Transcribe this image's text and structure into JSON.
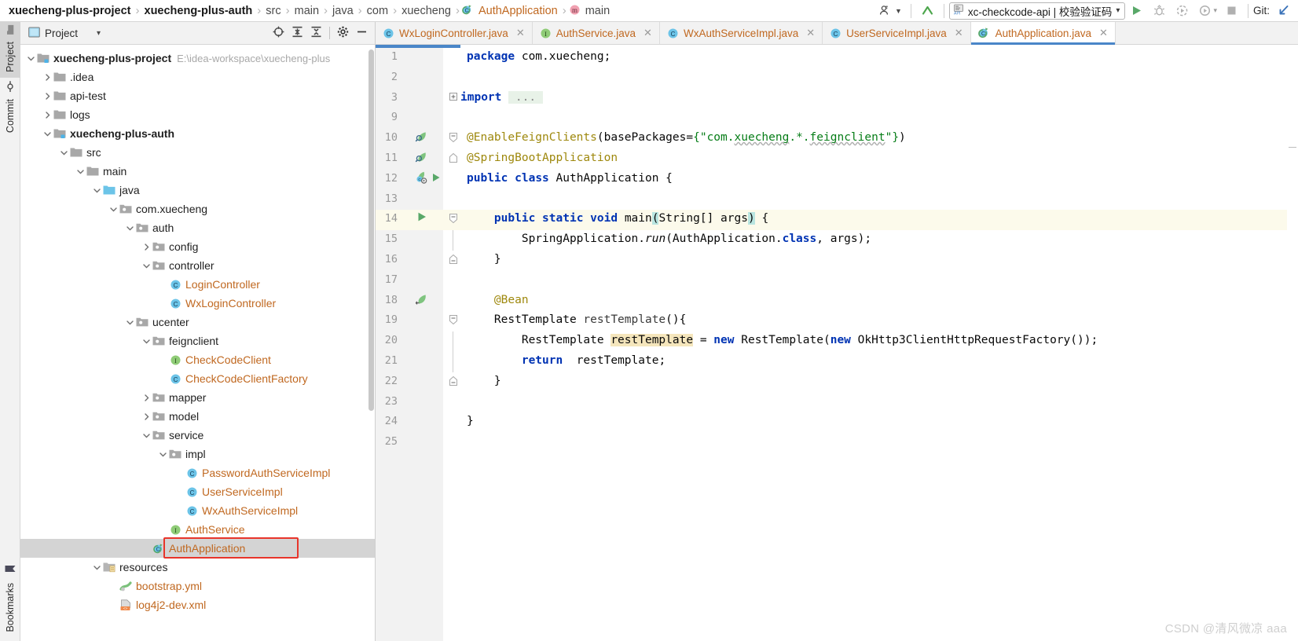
{
  "breadcrumb": {
    "items": [
      {
        "label": "xuecheng-plus-project",
        "style": "bold"
      },
      {
        "label": "xuecheng-plus-auth",
        "style": "bold"
      },
      {
        "label": "src",
        "style": "plain"
      },
      {
        "label": "main",
        "style": "plain"
      },
      {
        "label": "java",
        "style": "plain"
      },
      {
        "label": "com",
        "style": "plain"
      },
      {
        "label": "xuecheng",
        "style": "plain"
      },
      {
        "label": "AuthApplication",
        "style": "class",
        "icon": "spring-class-icon"
      },
      {
        "label": "main",
        "style": "method",
        "icon": "method-icon"
      }
    ],
    "separator": "›"
  },
  "toolbar": {
    "user_icon": "user-dropdown-icon",
    "updates_icon": "updates-arrow-icon",
    "run_config": {
      "icon": "api-icon",
      "label": "xc-checkcode-api | 校验验证码",
      "chevron": "▾"
    },
    "run_button": "run-icon",
    "debug_button": "debug-icon",
    "run_coverage_button": "run-with-coverage-icon",
    "profiler_button": "profiler-icon",
    "profiler_chevron": "▾",
    "stop_button": "stop-icon",
    "git_label": "Git:",
    "git_update_icon": "git-update-project-icon"
  },
  "stripe": {
    "top_tabs": [
      {
        "label": "Project",
        "icon": "project-folder-icon",
        "active": true
      },
      {
        "label": "Commit",
        "icon": "commit-icon",
        "active": false
      }
    ],
    "bottom_tabs": [
      {
        "label": "Bookmarks",
        "icon": "bookmark-icon",
        "active": false
      }
    ]
  },
  "project_panel": {
    "title": "Project",
    "title_icon": "project-view-icon",
    "chevron": "▾",
    "actions": [
      {
        "name": "select-opened-file-icon",
        "glyph": "target"
      },
      {
        "name": "expand-all-icon",
        "glyph": "expand"
      },
      {
        "name": "collapse-all-icon",
        "glyph": "collapse"
      },
      {
        "name": "settings-gear-icon",
        "glyph": "gear"
      },
      {
        "name": "hide-panel-icon",
        "glyph": "minus"
      }
    ],
    "tree": [
      {
        "depth": 0,
        "arrow": "down",
        "icon": "module-folder",
        "label": "xuecheng-plus-project",
        "bold": true,
        "path": "E:\\idea-workspace\\xuecheng-plus"
      },
      {
        "depth": 1,
        "arrow": "right",
        "icon": "folder",
        "label": ".idea",
        "bold": false
      },
      {
        "depth": 1,
        "arrow": "right",
        "icon": "folder",
        "label": "api-test",
        "bold": false
      },
      {
        "depth": 1,
        "arrow": "right",
        "icon": "folder",
        "label": "logs",
        "bold": false
      },
      {
        "depth": 1,
        "arrow": "down",
        "icon": "module-folder",
        "label": "xuecheng-plus-auth",
        "bold": true
      },
      {
        "depth": 2,
        "arrow": "down",
        "icon": "folder",
        "label": "src",
        "bold": false
      },
      {
        "depth": 3,
        "arrow": "down",
        "icon": "folder",
        "label": "main",
        "bold": false
      },
      {
        "depth": 4,
        "arrow": "down",
        "icon": "source-root",
        "label": "java",
        "bold": false
      },
      {
        "depth": 5,
        "arrow": "down",
        "icon": "package",
        "label": "com.xuecheng",
        "bold": false
      },
      {
        "depth": 6,
        "arrow": "down",
        "icon": "package",
        "label": "auth",
        "bold": false
      },
      {
        "depth": 7,
        "arrow": "right",
        "icon": "package",
        "label": "config",
        "bold": false
      },
      {
        "depth": 7,
        "arrow": "down",
        "icon": "package",
        "label": "controller",
        "bold": false
      },
      {
        "depth": 8,
        "arrow": "none",
        "icon": "class",
        "label": "LoginController",
        "bold": false
      },
      {
        "depth": 8,
        "arrow": "none",
        "icon": "class",
        "label": "WxLoginController",
        "bold": false
      },
      {
        "depth": 6,
        "arrow": "down",
        "icon": "package",
        "label": "ucenter",
        "bold": false
      },
      {
        "depth": 7,
        "arrow": "down",
        "icon": "package",
        "label": "feignclient",
        "bold": false
      },
      {
        "depth": 8,
        "arrow": "none",
        "icon": "interface",
        "label": "CheckCodeClient",
        "bold": false
      },
      {
        "depth": 8,
        "arrow": "none",
        "icon": "class",
        "label": "CheckCodeClientFactory",
        "bold": false
      },
      {
        "depth": 7,
        "arrow": "right",
        "icon": "package",
        "label": "mapper",
        "bold": false
      },
      {
        "depth": 7,
        "arrow": "right",
        "icon": "package",
        "label": "model",
        "bold": false
      },
      {
        "depth": 7,
        "arrow": "down",
        "icon": "package",
        "label": "service",
        "bold": false
      },
      {
        "depth": 8,
        "arrow": "down",
        "icon": "package",
        "label": "impl",
        "bold": false
      },
      {
        "depth": 9,
        "arrow": "none",
        "icon": "class",
        "label": "PasswordAuthServiceImpl",
        "bold": false
      },
      {
        "depth": 9,
        "arrow": "none",
        "icon": "class",
        "label": "UserServiceImpl",
        "bold": false
      },
      {
        "depth": 9,
        "arrow": "none",
        "icon": "class",
        "label": "WxAuthServiceImpl",
        "bold": false
      },
      {
        "depth": 8,
        "arrow": "none",
        "icon": "interface",
        "label": "AuthService",
        "bold": false
      },
      {
        "depth": 7,
        "arrow": "none",
        "icon": "spring-class",
        "label": "AuthApplication",
        "bold": false,
        "selected": true,
        "annotated": true
      },
      {
        "depth": 4,
        "arrow": "down",
        "icon": "resource-root",
        "label": "resources",
        "bold": false
      },
      {
        "depth": 5,
        "arrow": "none",
        "icon": "yaml",
        "label": "bootstrap.yml",
        "bold": false
      },
      {
        "depth": 5,
        "arrow": "none",
        "icon": "xml",
        "label": "log4j2-dev.xml",
        "bold": false
      }
    ]
  },
  "editor_tabs": [
    {
      "label": "WxLoginController.java",
      "icon": "class",
      "active": false,
      "close": "✕"
    },
    {
      "label": "AuthService.java",
      "icon": "interface",
      "active": false,
      "close": "✕"
    },
    {
      "label": "WxAuthServiceImpl.java",
      "icon": "class",
      "active": false,
      "close": "✕"
    },
    {
      "label": "UserServiceImpl.java",
      "icon": "class",
      "active": false,
      "close": "✕"
    },
    {
      "label": "AuthApplication.java",
      "icon": "spring-class",
      "active": true,
      "close": "✕"
    }
  ],
  "code": {
    "lines": [
      {
        "num": "1",
        "gutter": "none",
        "fold": "none"
      },
      {
        "num": "2",
        "gutter": "none",
        "fold": "none"
      },
      {
        "num": "3",
        "gutter": "none",
        "fold": "plus"
      },
      {
        "num": "9",
        "gutter": "none",
        "fold": "none"
      },
      {
        "num": "10",
        "gutter": "spring",
        "fold": "top"
      },
      {
        "num": "11",
        "gutter": "spring",
        "fold": "mid"
      },
      {
        "num": "12",
        "gutter": "spring-run",
        "fold": "none"
      },
      {
        "num": "13",
        "gutter": "none",
        "fold": "none"
      },
      {
        "num": "14",
        "gutter": "run",
        "fold": "top",
        "bulb": true,
        "highlight": true
      },
      {
        "num": "15",
        "gutter": "none",
        "fold": "bar"
      },
      {
        "num": "16",
        "gutter": "none",
        "fold": "bot"
      },
      {
        "num": "17",
        "gutter": "none",
        "fold": "none"
      },
      {
        "num": "18",
        "gutter": "bean",
        "fold": "none"
      },
      {
        "num": "19",
        "gutter": "none",
        "fold": "top"
      },
      {
        "num": "20",
        "gutter": "none",
        "fold": "bar"
      },
      {
        "num": "21",
        "gutter": "none",
        "fold": "bar"
      },
      {
        "num": "22",
        "gutter": "none",
        "fold": "bot"
      },
      {
        "num": "23",
        "gutter": "none",
        "fold": "none"
      },
      {
        "num": "24",
        "gutter": "none",
        "fold": "none"
      },
      {
        "num": "25",
        "gutter": "none",
        "fold": "none"
      }
    ],
    "text": [
      "package com.xuecheng;",
      "",
      "import ...",
      "",
      "@EnableFeignClients(basePackages={\"com.xuecheng.*.feignclient\"})",
      "@SpringBootApplication",
      "public class AuthApplication {",
      "",
      "    public static void main(String[] args) {",
      "        SpringApplication.run(AuthApplication.class, args);",
      "    }",
      "",
      "    @Bean",
      "    RestTemplate restTemplate(){",
      "        RestTemplate restTemplate = new RestTemplate(new OkHttp3ClientHttpRequestFactory());",
      "        return  restTemplate;",
      "    }",
      "",
      "}",
      ""
    ]
  },
  "watermark": "CSDN @清风微凉 aaa",
  "colors": {
    "accent_blue": "#4a86c8",
    "class_orange": "#c06820",
    "keyword_blue": "#0033b3",
    "string_green": "#067d17",
    "annotation_gold": "#9e880d",
    "selection_gray": "#d4d4d4",
    "annotation_red": "#e8352b",
    "caret_line": "#fcfaeb"
  }
}
